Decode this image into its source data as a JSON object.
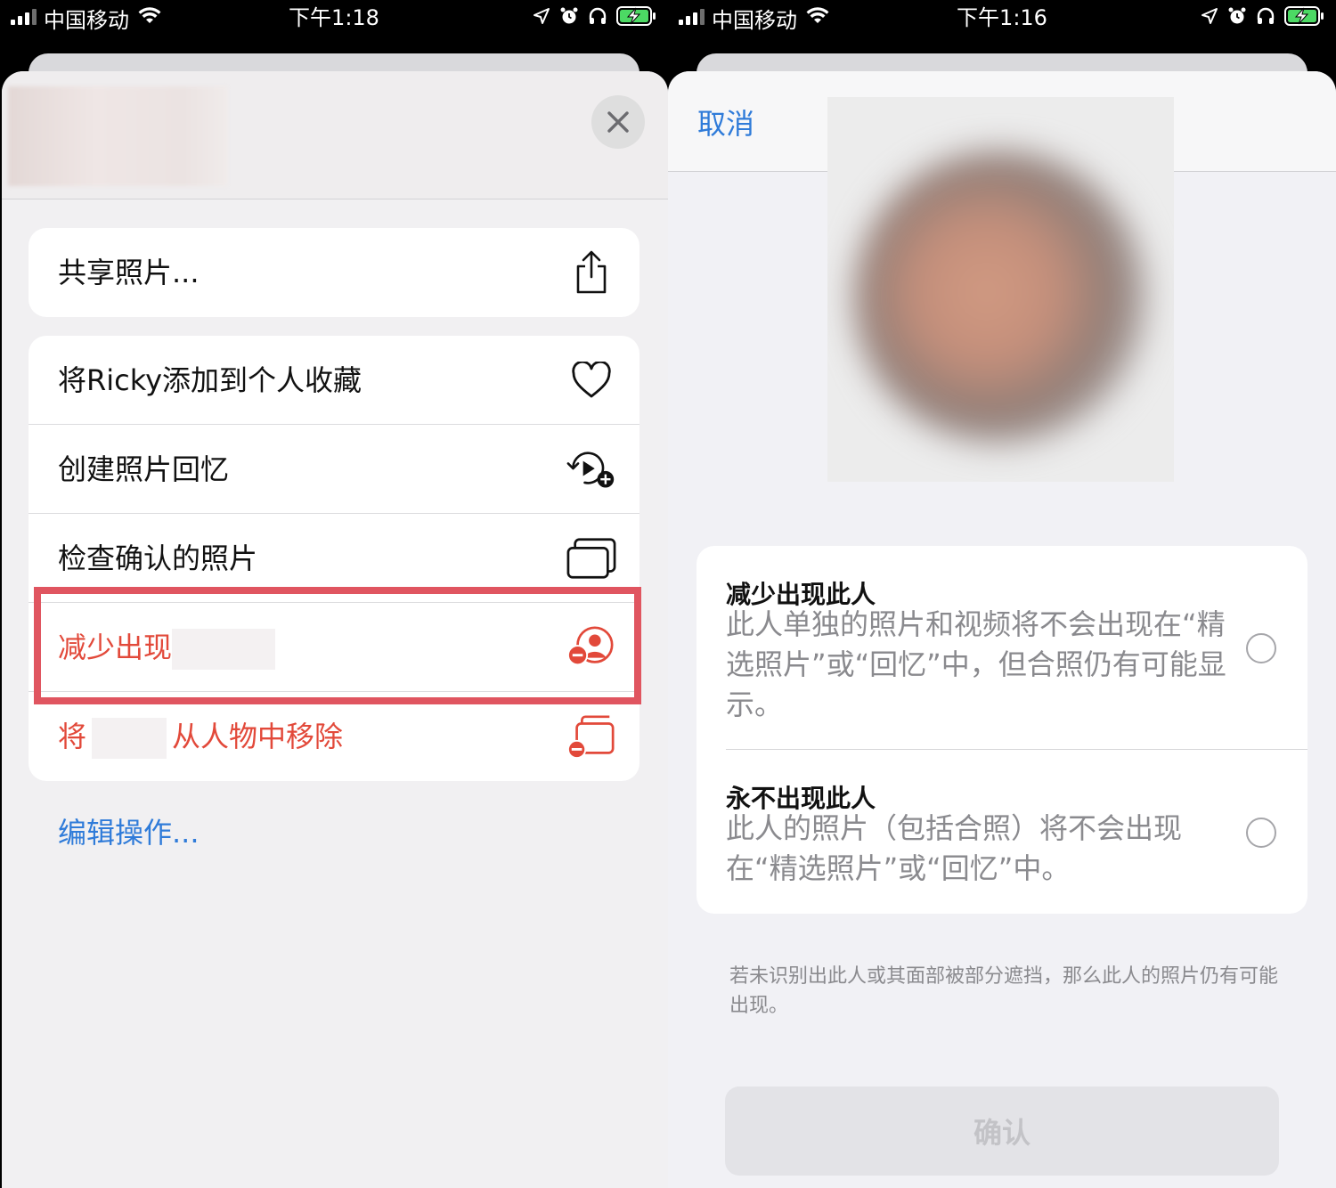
{
  "left": {
    "status": {
      "carrier": "中国移动",
      "time": "下午1:18"
    },
    "menu_group1": [
      {
        "label": "共享照片...",
        "icon": "share-icon"
      }
    ],
    "menu_group2": [
      {
        "label": "将Ricky添加到个人收藏",
        "icon": "heart-icon"
      },
      {
        "label": "创建照片回忆",
        "icon": "memory-play-plus-icon"
      },
      {
        "label": "检查确认的照片",
        "icon": "photo-stack-icon"
      },
      {
        "label": "减少出现",
        "icon": "person-minus-icon",
        "style": "destructive"
      },
      {
        "label_prefix": "将",
        "label_suffix": "从人物中移除",
        "icon": "remove-from-people-icon",
        "style": "destructive"
      }
    ],
    "edit_actions": "编辑操作..."
  },
  "right": {
    "status": {
      "carrier": "中国移动",
      "time": "下午1:16"
    },
    "cancel": "取消",
    "options": [
      {
        "title": "减少出现此人",
        "description": "此人单独的照片和视频将不会出现在“精选照片”或“回忆”中，但合照仍有可能显示。",
        "selected": false
      },
      {
        "title": "永不出现此人",
        "description": "此人的照片（包括合照）将不会出现在“精选照片”或“回忆”中。",
        "selected": false
      }
    ],
    "footnote": "若未识别出此人或其面部被部分遮挡，那么此人的照片仍有可能出现。",
    "confirm": "确认"
  },
  "colors": {
    "accent": "#2f7bd9",
    "destructive": "#e2493a",
    "highlight": "#e05560"
  }
}
